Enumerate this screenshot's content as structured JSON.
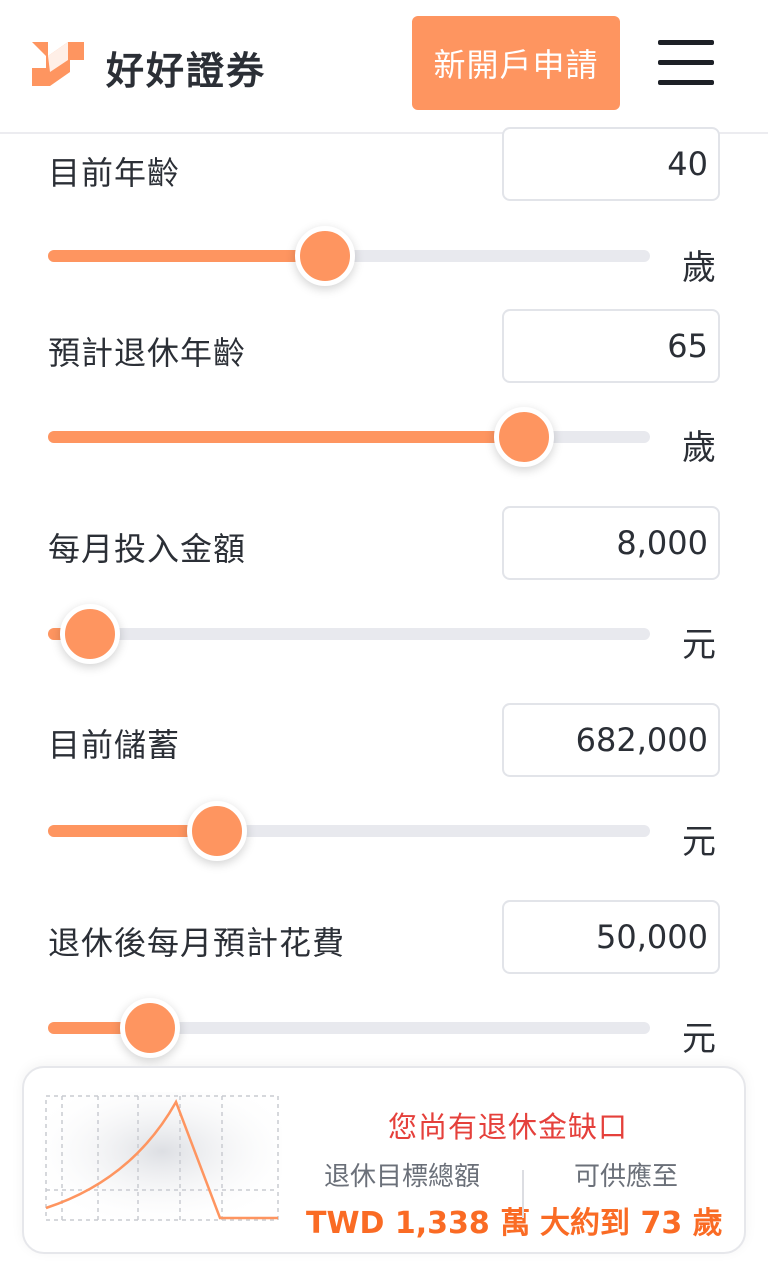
{
  "header": {
    "brand": "好好證券",
    "open_account_label": "新開戶申請"
  },
  "fields": [
    {
      "label": "目前年齡",
      "value": "40",
      "unit": "歲",
      "slider_fraction": 0.46
    },
    {
      "label": "預計退休年齡",
      "value": "65",
      "unit": "歲",
      "slider_fraction": 0.79
    },
    {
      "label": "每月投入金額",
      "value": "8,000",
      "unit": "元",
      "slider_fraction": 0.07
    },
    {
      "label": "目前儲蓄",
      "value": "682,000",
      "unit": "元",
      "slider_fraction": 0.28
    },
    {
      "label": "退休後每月預計花費",
      "value": "50,000",
      "unit": "元",
      "slider_fraction": 0.17
    }
  ],
  "summary": {
    "gap_title": "您尚有退休金缺口",
    "target_label": "退休目標總額",
    "target_value": "TWD 1,338 萬",
    "until_label": "可供應至",
    "until_value": "大約到 73 歲"
  },
  "colors": {
    "accent": "#fe9560",
    "warning_text": "#e5403b",
    "value_text": "#fa6b24"
  }
}
